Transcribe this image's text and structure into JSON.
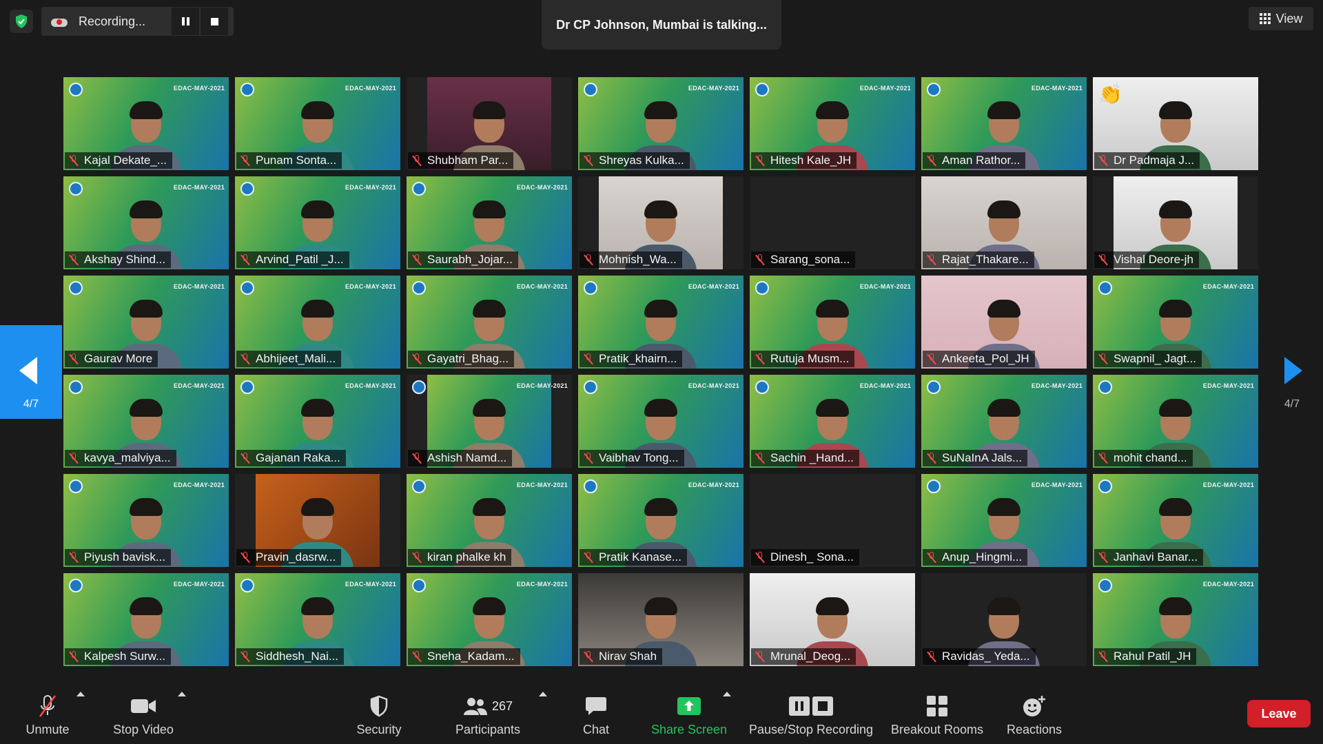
{
  "top": {
    "recording_label": "Recording...",
    "talking": "Dr CP Johnson, Mumbai is talking...",
    "view_label": "View"
  },
  "gallery": {
    "banner": "EDAC-MAY-2021",
    "page_left": "4/7",
    "page_right": "4/7",
    "participants": [
      [
        "Kajal Dekate_...",
        "Punam Sonta...",
        "Shubham Par...",
        "Shreyas Kulka...",
        "Hitesh Kale_JH",
        "Aman Rathor...",
        "Dr Padmaja J..."
      ],
      [
        "Akshay Shind...",
        "Arvind_Patil _J...",
        "Saurabh_Jojar...",
        "Mohnish_Wa...",
        "Sarang_sona...",
        "Rajat_Thakare...",
        "Vishal Deore-jh"
      ],
      [
        "Gaurav More",
        "Abhijeet_Mali...",
        "Gayatri_Bhag...",
        "Pratik_khairn...",
        "Rutuja Musm...",
        "Ankeeta_Pol_JH",
        "Swapnil_ Jagt..."
      ],
      [
        "kavya_malviya...",
        "Gajanan Raka...",
        "Ashish Namd...",
        "Vaibhav Tong...",
        "Sachin _Hand...",
        "SuNaInA Jals...",
        "mohit chand..."
      ],
      [
        "Piyush bavisk...",
        "Pravin_dasrw...",
        "kiran phalke kh",
        "Pratik Kanase...",
        "Dinesh_ Sona...",
        "Anup_Hingmi...",
        "Janhavi Banar..."
      ],
      [
        "Kalpesh Surw...",
        "Siddhesh_Nai...",
        "Sneha_Kadam...",
        "Nirav Shah",
        "Mrunal_Deog...",
        "Ravidas_ Yeda...",
        "Rahul Patil_JH"
      ]
    ]
  },
  "toolbar": {
    "unmute": "Unmute",
    "stop_video": "Stop Video",
    "security": "Security",
    "participants_count": "267",
    "participants": "Participants",
    "chat": "Chat",
    "share_screen": "Share Screen",
    "pause_stop_recording": "Pause/Stop Recording",
    "breakout_rooms": "Breakout Rooms",
    "reactions": "Reactions",
    "leave": "Leave"
  },
  "colors": {
    "accent_blue": "#1d8ff0",
    "share_green": "#23c45e",
    "leave_red": "#d21f28",
    "muted_red": "#ff4a4a"
  }
}
